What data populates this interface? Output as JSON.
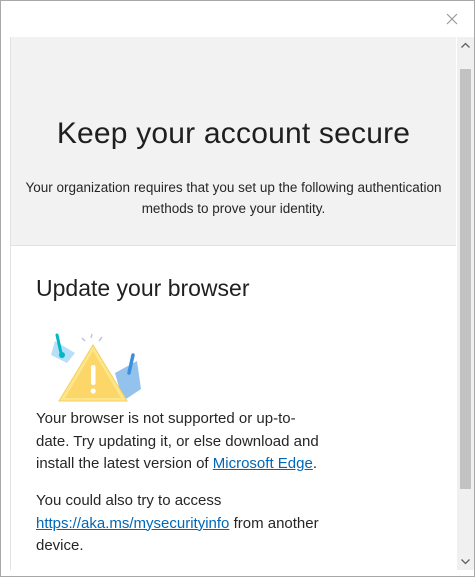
{
  "dialog": {
    "close_icon": "close-icon"
  },
  "header": {
    "title": "Keep your account secure",
    "subtitle_line1": "Your organization requires that you set up the following authentication",
    "subtitle_line2": "methods to prove your identity."
  },
  "section": {
    "title": "Update your browser",
    "illustration_icon": "browser-warning-illustration",
    "paragraph1_line1": "Your browser is not supported or up-to-",
    "paragraph1_line2": "date. Try updating it, or else download and",
    "paragraph1_line3_prefix": "install the latest version of ",
    "paragraph1_link": "Microsoft Edge",
    "paragraph1_line3_suffix": ".",
    "paragraph2_line1": "You could also try to access",
    "paragraph2_link": "https://aka.ms/mysecurityinfo",
    "paragraph2_link_suffix": " from another",
    "paragraph2_line3": "device."
  },
  "colors": {
    "link": "#0067b8",
    "header_band": "#f2f2f2",
    "warning_yellow": "#fce100",
    "accent_blue": "#3b8fde",
    "accent_teal": "#00b7c3"
  }
}
